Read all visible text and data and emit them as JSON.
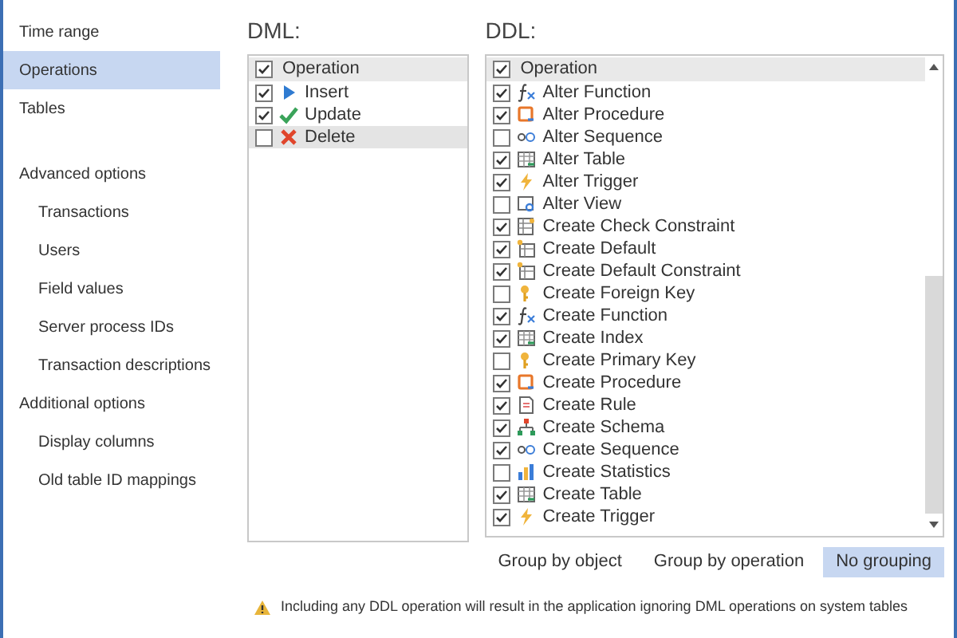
{
  "sidebar": {
    "items": [
      {
        "label": "Time range",
        "selected": false
      },
      {
        "label": "Operations",
        "selected": true
      },
      {
        "label": "Tables",
        "selected": false
      }
    ],
    "sections": [
      {
        "label": "Advanced options",
        "children": [
          {
            "label": "Transactions",
            "selected": false
          },
          {
            "label": "Users",
            "selected": false
          },
          {
            "label": "Field values",
            "selected": false
          },
          {
            "label": "Server process IDs",
            "selected": false
          },
          {
            "label": "Transaction descriptions",
            "selected": false
          }
        ]
      },
      {
        "label": "Additional options",
        "children": [
          {
            "label": "Display columns",
            "selected": false
          },
          {
            "label": "Old table ID mappings",
            "selected": false
          }
        ]
      }
    ]
  },
  "dml": {
    "title": "DML:",
    "header": {
      "label": "Operation",
      "checked": true
    },
    "rows": [
      {
        "label": "Insert",
        "kind": "insert",
        "checked": true,
        "selected": false
      },
      {
        "label": "Update",
        "kind": "update",
        "checked": true,
        "selected": false
      },
      {
        "label": "Delete",
        "kind": "delete",
        "checked": false,
        "selected": true
      }
    ]
  },
  "ddl": {
    "title": "DDL:",
    "header": {
      "label": "Operation",
      "checked": true
    },
    "rows": [
      {
        "label": "Alter Function",
        "kind": "function",
        "checked": true
      },
      {
        "label": "Alter Procedure",
        "kind": "procedure",
        "checked": true
      },
      {
        "label": "Alter Sequence",
        "kind": "sequence",
        "checked": false
      },
      {
        "label": "Alter Table",
        "kind": "table",
        "checked": true
      },
      {
        "label": "Alter Trigger",
        "kind": "trigger",
        "checked": true
      },
      {
        "label": "Alter View",
        "kind": "view",
        "checked": false
      },
      {
        "label": "Create Check Constraint",
        "kind": "constraint",
        "checked": true
      },
      {
        "label": "Create Default",
        "kind": "default",
        "checked": true
      },
      {
        "label": "Create Default Constraint",
        "kind": "default",
        "checked": true
      },
      {
        "label": "Create Foreign Key",
        "kind": "key",
        "checked": false
      },
      {
        "label": "Create Function",
        "kind": "function",
        "checked": true
      },
      {
        "label": "Create Index",
        "kind": "table",
        "checked": true
      },
      {
        "label": "Create Primary Key",
        "kind": "key",
        "checked": false
      },
      {
        "label": "Create Procedure",
        "kind": "procedure",
        "checked": true
      },
      {
        "label": "Create Rule",
        "kind": "rule",
        "checked": true
      },
      {
        "label": "Create Schema",
        "kind": "schema",
        "checked": true
      },
      {
        "label": "Create Sequence",
        "kind": "sequence",
        "checked": true
      },
      {
        "label": "Create Statistics",
        "kind": "statistics",
        "checked": false
      },
      {
        "label": "Create Table",
        "kind": "table",
        "checked": true
      },
      {
        "label": "Create Trigger",
        "kind": "trigger",
        "checked": true
      }
    ]
  },
  "grouping": [
    {
      "label": "Group by object",
      "selected": false
    },
    {
      "label": "Group by operation",
      "selected": false
    },
    {
      "label": "No grouping",
      "selected": true
    }
  ],
  "warning": "Including any DDL operation will result in the application ignoring DML operations on system tables"
}
